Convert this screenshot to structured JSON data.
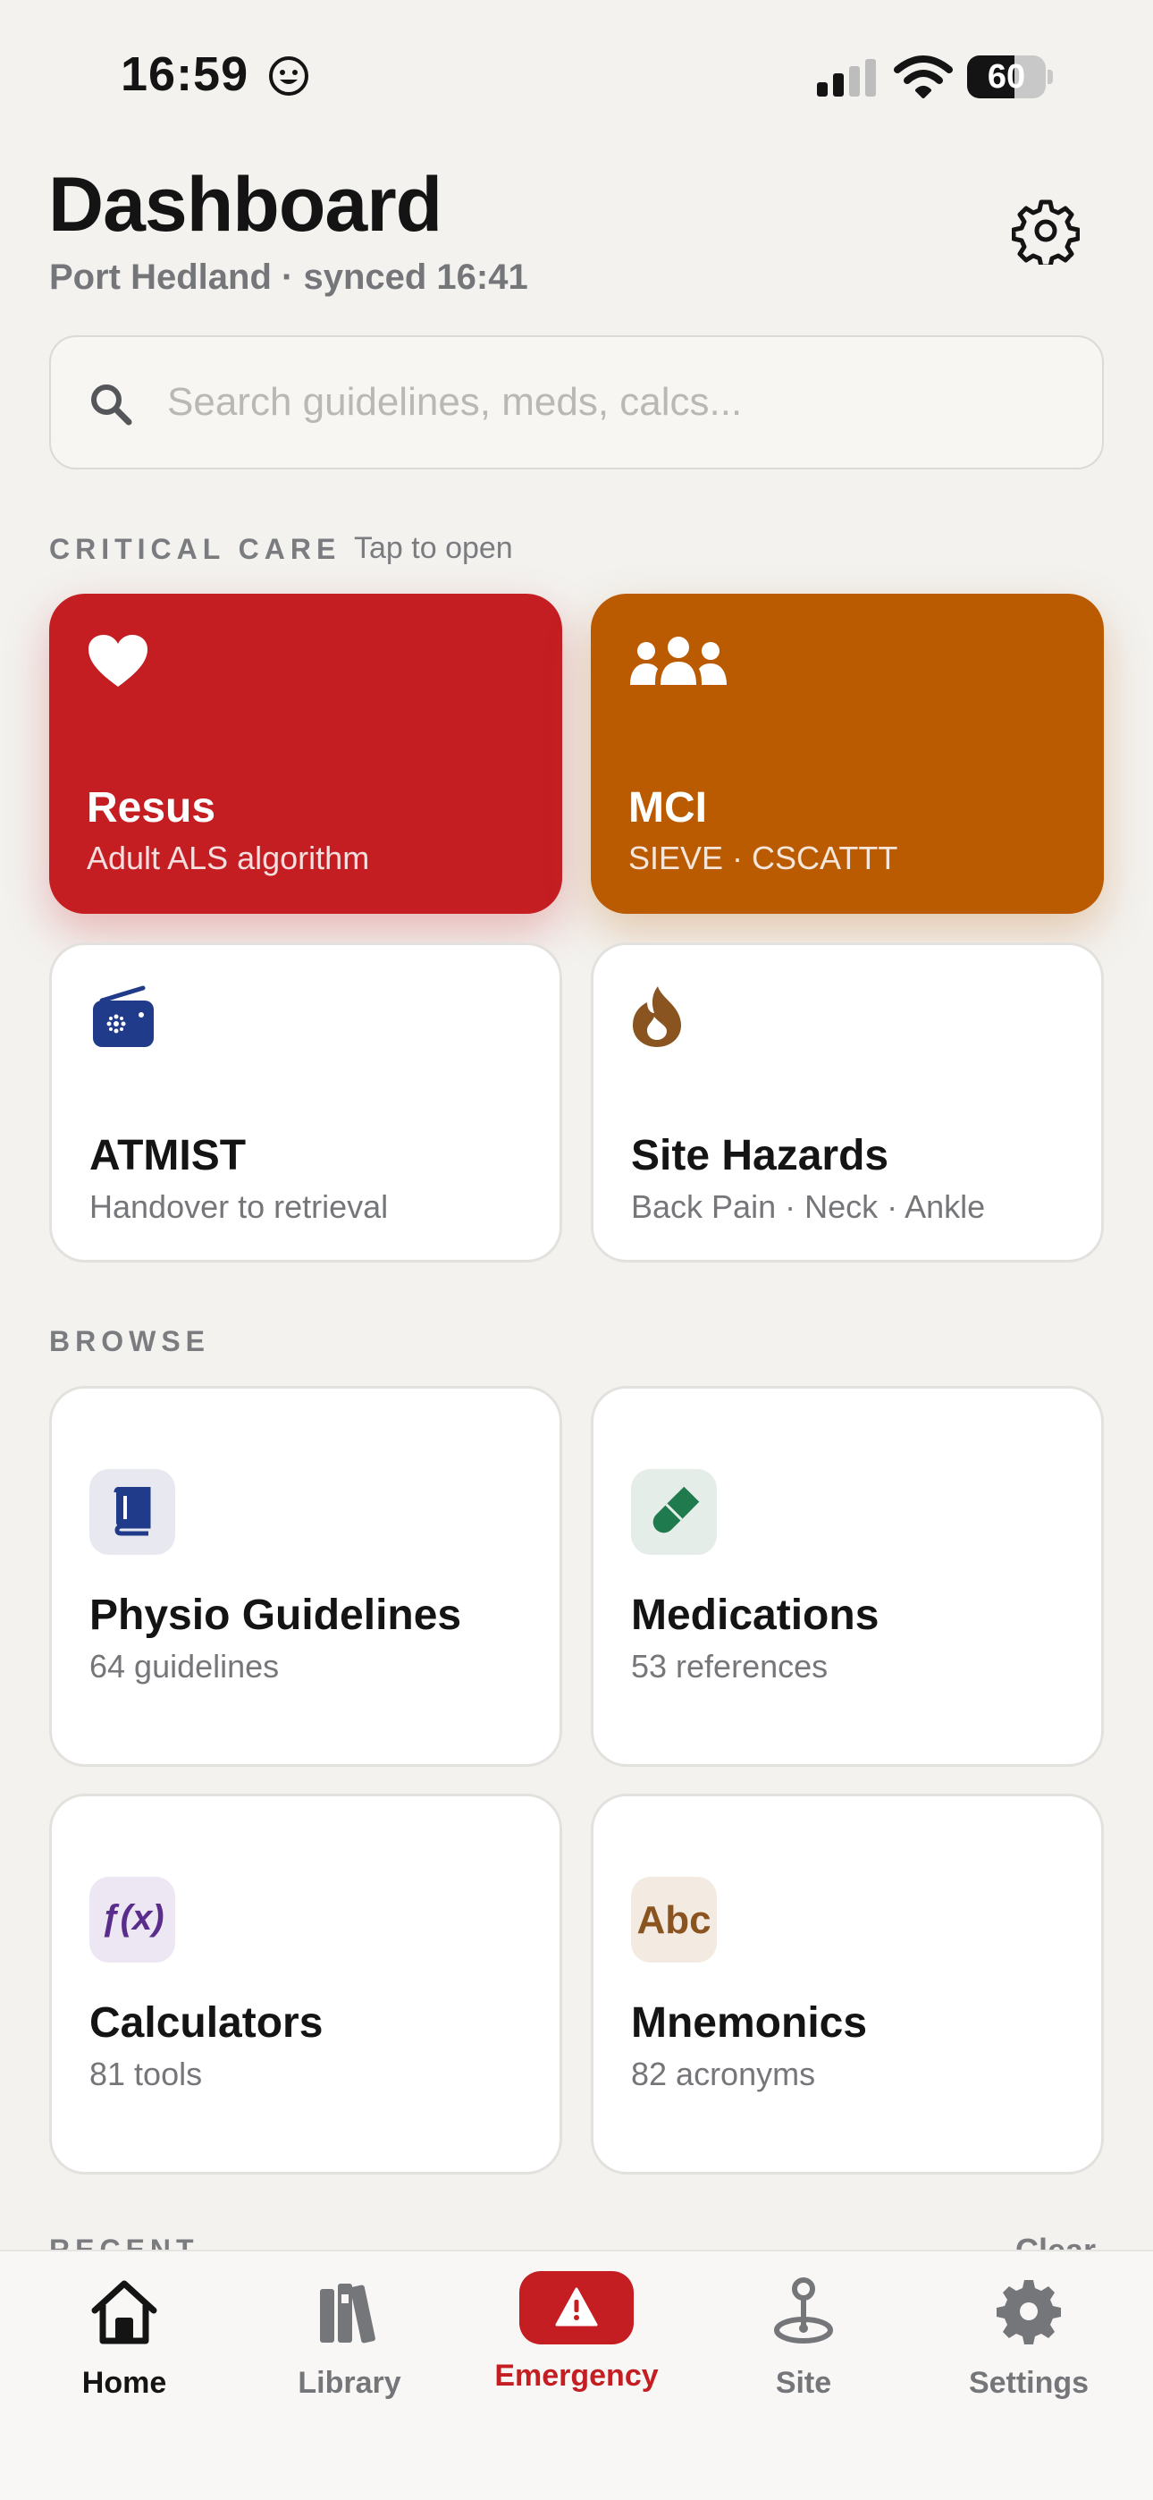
{
  "status_bar": {
    "time": "16:59",
    "battery_percent": "60",
    "battery_level": 0.6
  },
  "header": {
    "title": "Dashboard",
    "subtitle": "Port Hedland · synced 16:41"
  },
  "search": {
    "placeholder": "Search guidelines, meds, calcs..."
  },
  "critical_care": {
    "label": "CRITICAL CARE",
    "hint": "Tap to open",
    "cards": [
      {
        "title": "Resus",
        "desc": "Adult ALS algorithm",
        "icon": "heart-icon",
        "color": "#c41e22"
      },
      {
        "title": "MCI",
        "desc": "SIEVE · CSCATTT",
        "icon": "people-icon",
        "color": "#ba5b02"
      },
      {
        "title": "ATMIST",
        "desc": "Handover to retrieval",
        "icon": "radio-icon",
        "color": "#1f3b8a"
      },
      {
        "title": "Site Hazards",
        "desc": "Back Pain · Neck · Ankle",
        "icon": "flame-icon",
        "color": "#8a5420"
      }
    ]
  },
  "browse": {
    "label": "BROWSE",
    "cards": [
      {
        "title": "Physio Guidelines",
        "desc": "64 guidelines",
        "icon": "book-icon",
        "color": "#1f3b8a"
      },
      {
        "title": "Medications",
        "desc": "53 references",
        "icon": "pill-icon",
        "color": "#1f7a4d"
      },
      {
        "title": "Calculators",
        "desc": "81 tools",
        "icon": "function-icon",
        "glyph": "ƒ(x)",
        "color": "#5a2d8c"
      },
      {
        "title": "Mnemonics",
        "desc": "82 acronyms",
        "icon": "abc-icon",
        "glyph": "Abc",
        "color": "#8a5420"
      }
    ]
  },
  "recent": {
    "label": "RECENT",
    "clear": "Clear"
  },
  "tabbar": {
    "tabs": [
      {
        "label": "Home",
        "icon": "home-icon",
        "active": true
      },
      {
        "label": "Library",
        "icon": "library-icon"
      },
      {
        "label": "Emergency",
        "icon": "warning-icon"
      },
      {
        "label": "Site",
        "icon": "joystick-icon"
      },
      {
        "label": "Settings",
        "icon": "gear-icon"
      }
    ]
  }
}
